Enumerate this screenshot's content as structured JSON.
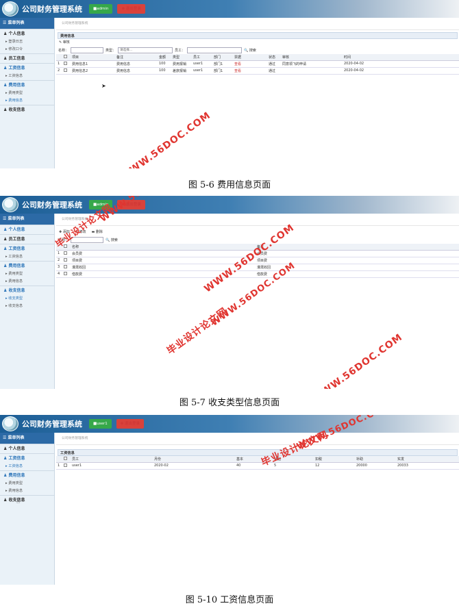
{
  "app_title": "公司财务管理系统",
  "logout": "⊗ 退出登录",
  "menu_head": "☰ 菜单列表",
  "fig1": {
    "user": "■admin",
    "menu": [
      {
        "t": "sec",
        "label": "♟ 个人信息"
      },
      {
        "t": "sub",
        "label": "▸ 登录日志"
      },
      {
        "t": "sub",
        "label": "▸ 修改口令"
      },
      {
        "t": "sec",
        "label": "♟ 员工信息"
      },
      {
        "t": "sec",
        "label": "♟ 工资信息",
        "hl": true
      },
      {
        "t": "sub",
        "label": "▸ 工资信息"
      },
      {
        "t": "sec",
        "label": "♟ 费用信息",
        "hl": true
      },
      {
        "t": "sub",
        "label": "▸ 费用类型"
      },
      {
        "t": "sub",
        "label": "▸ 费用信息",
        "hl": true
      },
      {
        "t": "sec",
        "label": "♟ 收支信息"
      }
    ],
    "crumb": "公司财务管理系统",
    "panel": "费用信息",
    "toolbar": [
      "✎ 审核"
    ],
    "search": {
      "name_label": "名称：",
      "type_label": "类型：",
      "type_placeholder": "请选择...",
      "emp_label": "员工：",
      "button": "🔍 搜索"
    },
    "columns": [
      "",
      "",
      "项目",
      "备注",
      "金额",
      "类型",
      "员工",
      "部门",
      "票据",
      "状态",
      "审核",
      "时间"
    ],
    "rows": [
      [
        "1",
        "",
        "费用信息1",
        "费用信息",
        "100",
        "费用报销",
        "user1",
        "部门1",
        "查看",
        "通过",
        "同意领飞的申请",
        "2020-04-02"
      ],
      [
        "2",
        "",
        "费用信息2",
        "费用信息",
        "100",
        "差旅报销",
        "user1",
        "部门1",
        "查看",
        "通过",
        "",
        "2020-04-02"
      ]
    ],
    "caption": "图 5-6 费用信息页面"
  },
  "fig2": {
    "user": "■admin",
    "menu": [
      {
        "t": "sec",
        "label": "♟ 个人信息",
        "hl": true
      },
      {
        "t": "sec",
        "label": "♟ 员工信息"
      },
      {
        "t": "sec",
        "label": "♟ 工资信息",
        "hl": true
      },
      {
        "t": "sub",
        "label": "▸ 工资信息"
      },
      {
        "t": "sec",
        "label": "♟ 费用信息",
        "hl": true
      },
      {
        "t": "sub",
        "label": "▸ 费用类型"
      },
      {
        "t": "sub",
        "label": "▸ 费用信息"
      },
      {
        "t": "sec",
        "label": "♟ 收支信息",
        "hl": true
      },
      {
        "t": "sub",
        "label": "▸ 收支类型",
        "hl": true
      },
      {
        "t": "sub",
        "label": "▸ 收支信息"
      }
    ],
    "crumb": "公司财务管理系统",
    "toolbar": [
      "✚ 添加",
      "✎ 修改",
      "▬ 删除"
    ],
    "search": {
      "name_label": "名称：",
      "button": "🔍 搜索"
    },
    "columns": [
      "",
      "",
      "名称",
      "备注"
    ],
    "rows": [
      [
        "1",
        "",
        "会员费",
        "会员费"
      ],
      [
        "2",
        "",
        "项目费",
        "项目费"
      ],
      [
        "3",
        "",
        "灌溉收回",
        "灌溉收回"
      ],
      [
        "4",
        "",
        "借款费",
        "借款费"
      ]
    ],
    "caption": "图 5-7 收支类型信息页面"
  },
  "fig3": {
    "user": "■user1",
    "menu": [
      {
        "t": "sec",
        "label": "♟ 个人信息"
      },
      {
        "t": "sec",
        "label": "♟ 工资信息",
        "hl": true
      },
      {
        "t": "sub",
        "label": "▸ 工资信息",
        "hl": true
      },
      {
        "t": "sec",
        "label": "♟ 费用信息",
        "hl": true
      },
      {
        "t": "sub",
        "label": "▸ 费用类型"
      },
      {
        "t": "sub",
        "label": "▸ 费用信息"
      },
      {
        "t": "sec",
        "label": "♟ 收支信息"
      }
    ],
    "crumb": "公司财务管理系统",
    "panel": "工资信息",
    "columns": [
      "",
      "",
      "员工",
      "月份",
      "基本",
      "补贴",
      "扣税",
      "补助",
      "实发"
    ],
    "rows": [
      [
        "1",
        "",
        "user1",
        "2020-02",
        "40",
        "5",
        "12",
        "20000",
        "20033"
      ]
    ],
    "caption": "图 5-10 工资信息页面"
  },
  "watermarks": [
    "WWW.56DOC.COM",
    "毕业设计论文网"
  ]
}
